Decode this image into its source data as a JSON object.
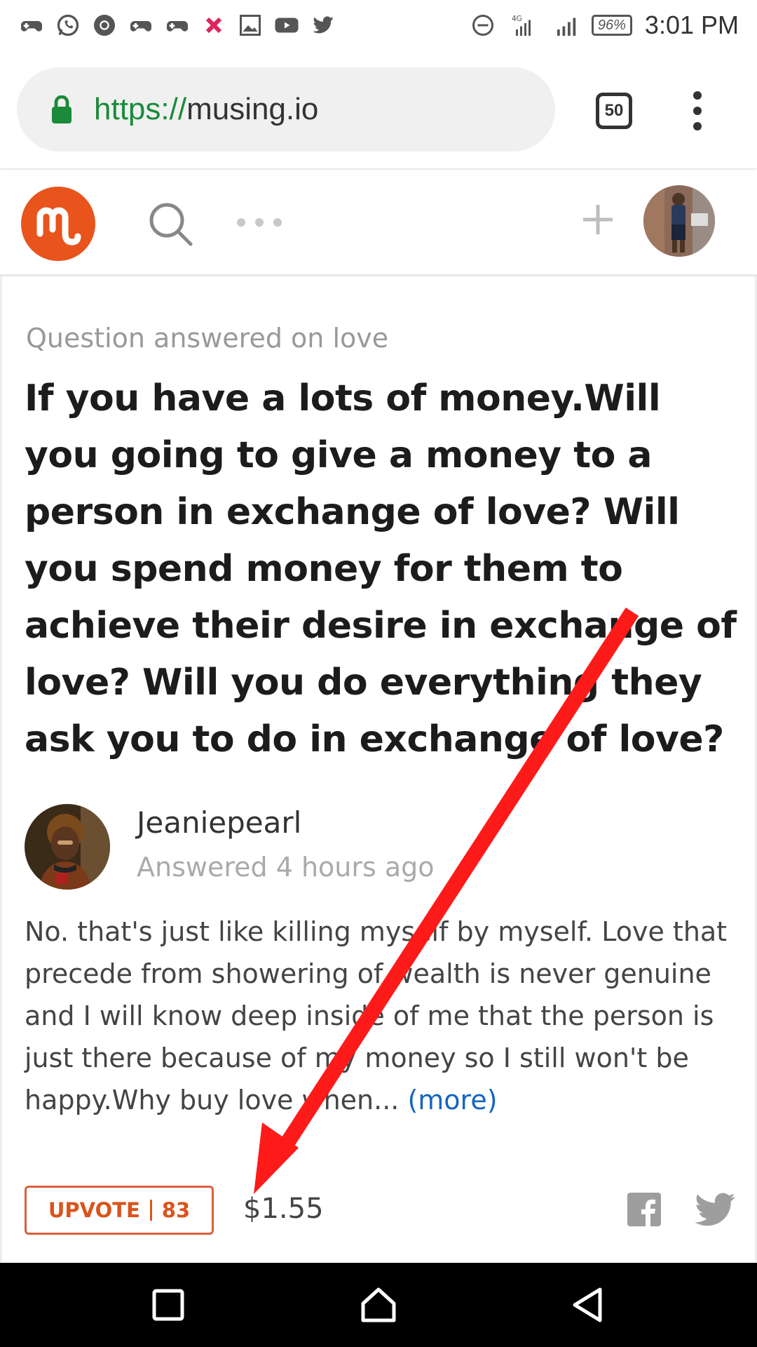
{
  "status_bar": {
    "time": "3:01 PM",
    "battery": "96%",
    "network": "4G"
  },
  "browser": {
    "url_scheme": "https://",
    "url_host": "musing.io",
    "tab_count": "50"
  },
  "question": {
    "meta": "Question answered on love",
    "title": "If you have a lots of money.Will you going to give a money to a person in exchange of love? Will you spend money for them to achieve their desire in exchange of love? Will you do everything they ask you to do in exchange of love?"
  },
  "answer": {
    "author": "Jeaniepearl",
    "time": "Answered 4 hours ago",
    "text": "No. that's just like killing myself by myself. Love that precede from showering of wealth is never genuine and I will know deep inside of me that the person is just there because of my money so I still won't be happy.Why buy love when...",
    "more_label": "(more)",
    "upvote_label": "UPVOTE",
    "upvote_count": "83",
    "earnings": "$1.55"
  },
  "colors": {
    "brand": "#e8541c",
    "link": "#1565c0",
    "arrow": "#ff1a1a"
  }
}
